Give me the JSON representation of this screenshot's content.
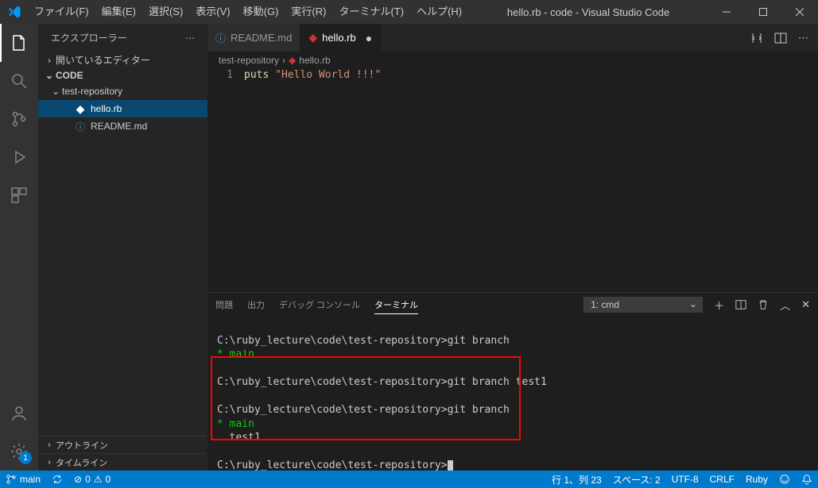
{
  "window": {
    "title": "hello.rb - code - Visual Studio Code"
  },
  "menu": [
    "ファイル(F)",
    "編集(E)",
    "選択(S)",
    "表示(V)",
    "移動(G)",
    "実行(R)",
    "ターミナル(T)",
    "ヘルプ(H)"
  ],
  "sidebar": {
    "title": "エクスプローラー",
    "open_editors": "開いているエディター",
    "workspace": "CODE",
    "folder": "test-repository",
    "files": [
      {
        "name": "hello.rb",
        "icon": "ruby",
        "selected": true
      },
      {
        "name": "README.md",
        "icon": "info",
        "selected": false
      }
    ],
    "outline": "アウトライン",
    "timeline": "タイムライン"
  },
  "tabs": [
    {
      "label": "README.md",
      "icon": "info",
      "active": false,
      "dirty": false
    },
    {
      "label": "hello.rb",
      "icon": "ruby",
      "active": true,
      "dirty": true
    }
  ],
  "breadcrumbs": {
    "part1": "test-repository",
    "part2": "hello.rb"
  },
  "code": {
    "line_no": "1",
    "token_puts": "puts",
    "token_string": "\"Hello World !!!\""
  },
  "panel": {
    "tabs": [
      "問題",
      "出力",
      "デバッグ コンソール",
      "ターミナル"
    ],
    "active_tab": 3,
    "terminal_select": "1: cmd"
  },
  "terminal": {
    "prompt": "C:\\ruby_lecture\\code\\test-repository>",
    "cmd1": "git branch",
    "out1": "* main",
    "cmd2": "git branch test1",
    "cmd3": "git branch",
    "out3a": "* main",
    "out3b": "  test1"
  },
  "status": {
    "branch": "main",
    "errors": "0",
    "warnings": "0",
    "cursor": "行 1、列 23",
    "spaces": "スペース: 2",
    "encoding": "UTF-8",
    "eol": "CRLF",
    "lang": "Ruby",
    "settings_badge": "1"
  }
}
